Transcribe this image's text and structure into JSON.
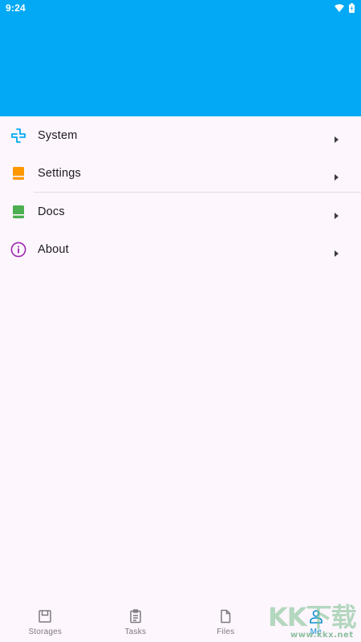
{
  "status_bar": {
    "time": "9:24",
    "icons": [
      "wifi-icon",
      "battery-icon"
    ]
  },
  "header": {
    "color": "#03a9f4"
  },
  "menu": {
    "items": [
      {
        "label": "System",
        "icon": "system-icon",
        "icon_color": "#03a9f4"
      },
      {
        "label": "Settings",
        "icon": "settings-icon",
        "icon_color": "#ff9800"
      },
      {
        "label": "Docs",
        "icon": "docs-icon",
        "icon_color": "#4caf50"
      },
      {
        "label": "About",
        "icon": "about-icon",
        "icon_color": "#9c27b0"
      }
    ]
  },
  "bottom_nav": {
    "items": [
      {
        "label": "Storages",
        "icon": "storages-icon",
        "active": false
      },
      {
        "label": "Tasks",
        "icon": "tasks-icon",
        "active": false
      },
      {
        "label": "Files",
        "icon": "files-icon",
        "active": false
      },
      {
        "label": "Me",
        "icon": "me-icon",
        "active": true
      }
    ]
  },
  "watermark": {
    "text": "KK下载",
    "url": "www.kkx.net"
  }
}
